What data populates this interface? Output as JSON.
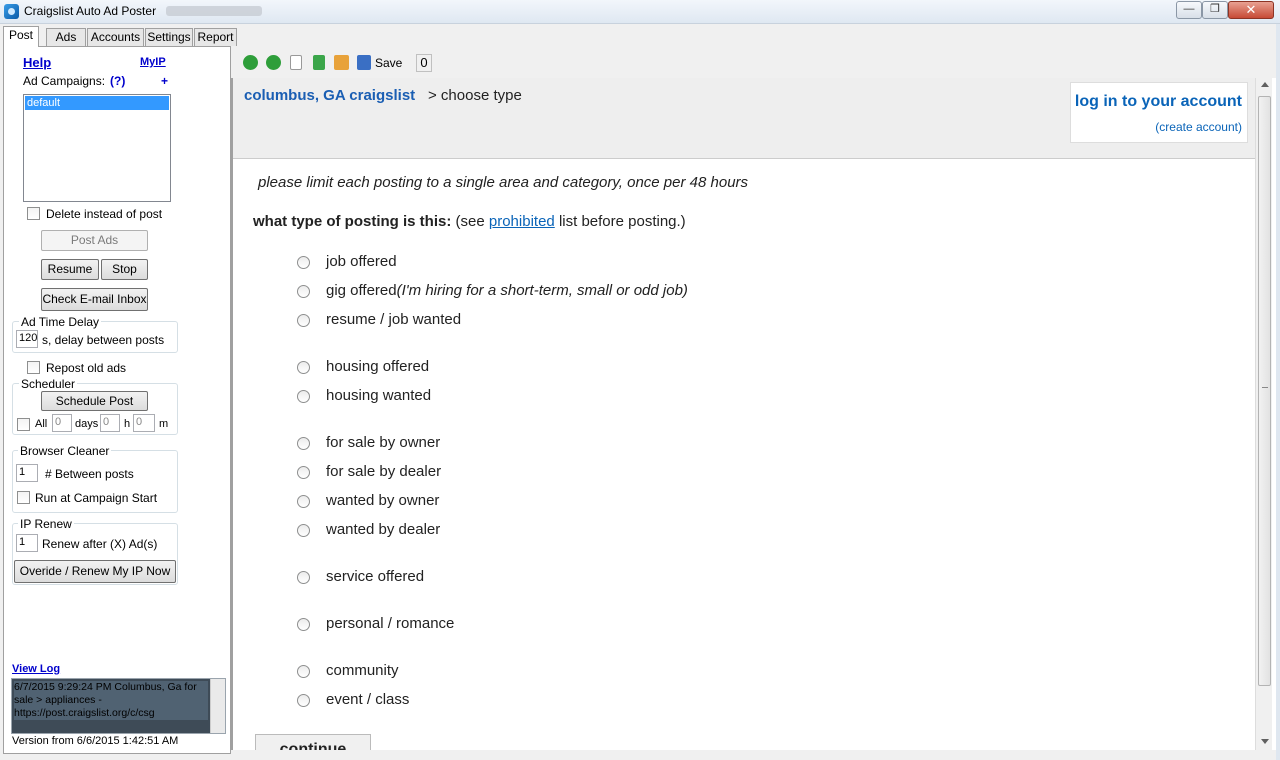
{
  "window": {
    "title": "Craigslist Auto Ad Poster",
    "min_label": "—",
    "max_label": "❐",
    "close_label": "✕"
  },
  "tabs": [
    "Post",
    "Ads",
    "Accounts",
    "Settings",
    "Report"
  ],
  "left": {
    "help_label": "Help",
    "myip_label": "MyIP",
    "campaigns_label": "Ad Campaigns:",
    "campaigns_help": "(?)",
    "campaigns_add": "+",
    "campaigns": [
      "default"
    ],
    "delete_label": "Delete instead of post",
    "post_ads_label": "Post Ads",
    "resume_label": "Resume",
    "stop_label": "Stop",
    "check_email_label": "Check E-mail Inbox",
    "time_delay_title": "Ad Time Delay",
    "delay_value": "120",
    "delay_label": "s, delay between posts",
    "repost_label": "Repost old ads",
    "scheduler_title": "Scheduler",
    "schedule_button": "Schedule Post",
    "all_label": "All",
    "days_value": "0",
    "days_label": "days",
    "hours_value": "0",
    "hours_label": "h",
    "minutes_value": "0",
    "minutes_label": "m",
    "cleaner_title": "Browser Cleaner",
    "between_value": "1",
    "between_label": "# Between posts",
    "run_start_label": "Run at Campaign Start",
    "ip_title": "IP Renew",
    "renew_value": "1",
    "renew_label": "Renew after (X) Ad(s)",
    "override_label": "Overide / Renew My IP Now",
    "view_log_label": "View Log",
    "log_text": "6/7/2015 9:29:24 PM  Columbus, Ga for sale > appliances - https://post.craigslist.org/c/csg",
    "version": "Version from 6/6/2015 1:42:51 AM"
  },
  "toolbar": {
    "icons": [
      "back-icon",
      "forward-icon",
      "stop-icon",
      "refresh-icon",
      "home-icon",
      "save-icon"
    ],
    "save_label": "Save",
    "count": "0"
  },
  "page": {
    "city": "columbus, GA craigslist",
    "crumb_rest": "> choose type",
    "login_label": "log in to your account",
    "create_account_label": "(create account)",
    "notice": "please limit each posting to a single area and category, once per 48 hours",
    "question_bold": "what type of posting is this:",
    "question_pre": "(see",
    "question_link": "prohibited",
    "question_post": "list before posting.)",
    "options": [
      {
        "label": "job offered",
        "note": ""
      },
      {
        "label": "gig offered",
        "note": "(I'm hiring for a short-term, small or odd job)"
      },
      {
        "label": "resume / job wanted",
        "note": ""
      },
      {
        "label": "housing offered",
        "note": ""
      },
      {
        "label": "housing wanted",
        "note": ""
      },
      {
        "label": "for sale by owner",
        "note": ""
      },
      {
        "label": "for sale by dealer",
        "note": ""
      },
      {
        "label": "wanted by owner",
        "note": ""
      },
      {
        "label": "wanted by dealer",
        "note": ""
      },
      {
        "label": "service offered",
        "note": ""
      },
      {
        "label": "personal / romance",
        "note": ""
      },
      {
        "label": "community",
        "note": ""
      },
      {
        "label": "event / class",
        "note": ""
      }
    ],
    "continue_label": "continue"
  },
  "colors": {
    "link": "#1a5eb3",
    "selection": "#3399ff"
  }
}
